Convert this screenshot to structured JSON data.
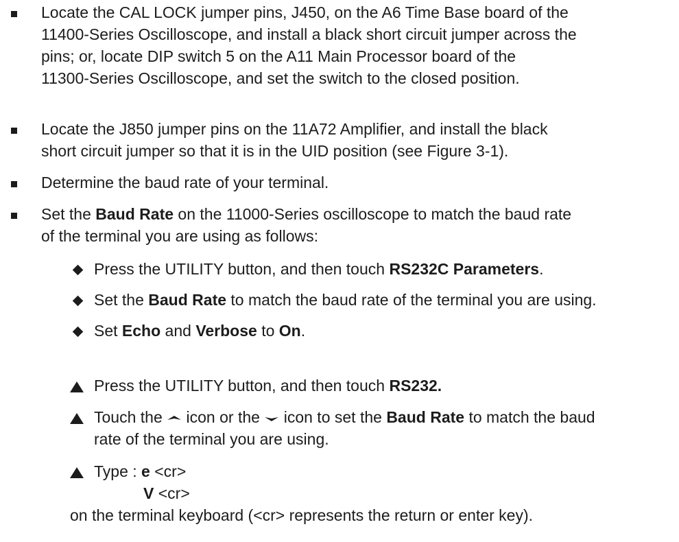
{
  "items": [
    {
      "lines": [
        "Locate the CAL LOCK jumper pins, J450, on the A6 Time Base board of the",
        "11400-Series Oscilloscope, and install a black short circuit jumper across the",
        "pins; or, locate DIP switch 5 on the A11 Main Processor board of the",
        "11300-Series Oscilloscope, and set the switch to the closed position."
      ]
    },
    {
      "lines": [
        "Locate the J850 jumper pins on the 11A72 Amplifier, and install the black",
        "short circuit jumper so that it is in the UID position (see Figure 3-1)."
      ]
    },
    {
      "lines": [
        "Determine the baud rate of your terminal."
      ]
    },
    {
      "line1_pre": "Set the ",
      "line1_bold": "Baud Rate",
      "line1_post": " on the 11000-Series oscilloscope to match the baud rate",
      "line2": "of the terminal you are using as follows:"
    }
  ],
  "diamonds": {
    "d1_pre": "Press the UTILITY button, and then touch ",
    "d1_bold": "RS232C Parameters",
    "d1_post": ".",
    "d2_pre": "Set the ",
    "d2_bold": "Baud Rate",
    "d2_post": " to match the baud rate of the terminal you are using.",
    "d3_pre": "Set ",
    "d3_bold1": "Echo",
    "d3_mid": " and ",
    "d3_bold2": "Verbose",
    "d3_mid2": " to ",
    "d3_bold3": "On",
    "d3_post": "."
  },
  "triangles": {
    "t1_pre": "Press the UTILITY button, and then touch ",
    "t1_bold": "RS232.",
    "t2_a": "Touch the ",
    "t2_b": " icon or the ",
    "t2_c": " icon to set the ",
    "t2_bold": "Baud Rate",
    "t2_d": " to match the baud",
    "t2_line2": "rate of the terminal you are using.",
    "t3_pre": "Type : ",
    "t3_cmd1": "e",
    "t3_cr1": " <cr>",
    "t3_cmd2": "V",
    "t3_cr2": " <cr>",
    "t3_last": "on the terminal keyboard (<cr> represents the return or enter key)."
  },
  "icons": {
    "bullet": "square-bullet-icon",
    "diamond": "diamond-bullet-icon",
    "triangle": "triangle-bullet-icon",
    "up_arrow": "up-arrow-icon",
    "down_arrow": "down-arrow-icon"
  }
}
